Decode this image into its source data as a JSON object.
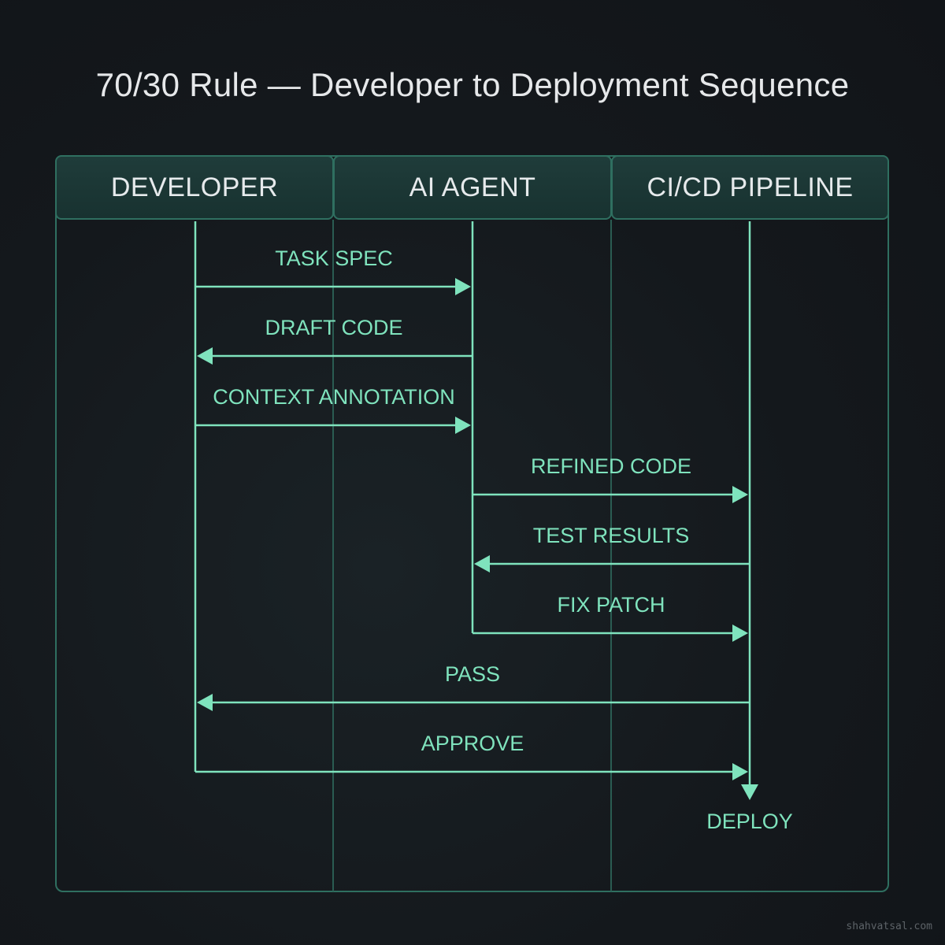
{
  "title": "70/30 Rule — Developer to Deployment Sequence",
  "participants": [
    "DEVELOPER",
    "AI AGENT",
    "CI/CD PIPELINE"
  ],
  "messages": [
    {
      "label": "TASK SPEC",
      "from": 0,
      "to": 1
    },
    {
      "label": "DRAFT CODE",
      "from": 1,
      "to": 0
    },
    {
      "label": "CONTEXT ANNOTATION",
      "from": 0,
      "to": 1
    },
    {
      "label": "REFINED CODE",
      "from": 1,
      "to": 2
    },
    {
      "label": "TEST RESULTS",
      "from": 2,
      "to": 1
    },
    {
      "label": "FIX PATCH",
      "from": 1,
      "to": 2
    },
    {
      "label": "PASS",
      "from": 2,
      "to": 0
    },
    {
      "label": "APPROVE",
      "from": 0,
      "to": 2
    }
  ],
  "terminal": {
    "label": "DEPLOY",
    "participant": 2
  },
  "colors": {
    "accent": "#7fe3bd",
    "frame": "#2f6f60",
    "header_bg": "#1f3c3a",
    "background": "#14181c"
  },
  "watermark": "shahvatsal.com"
}
